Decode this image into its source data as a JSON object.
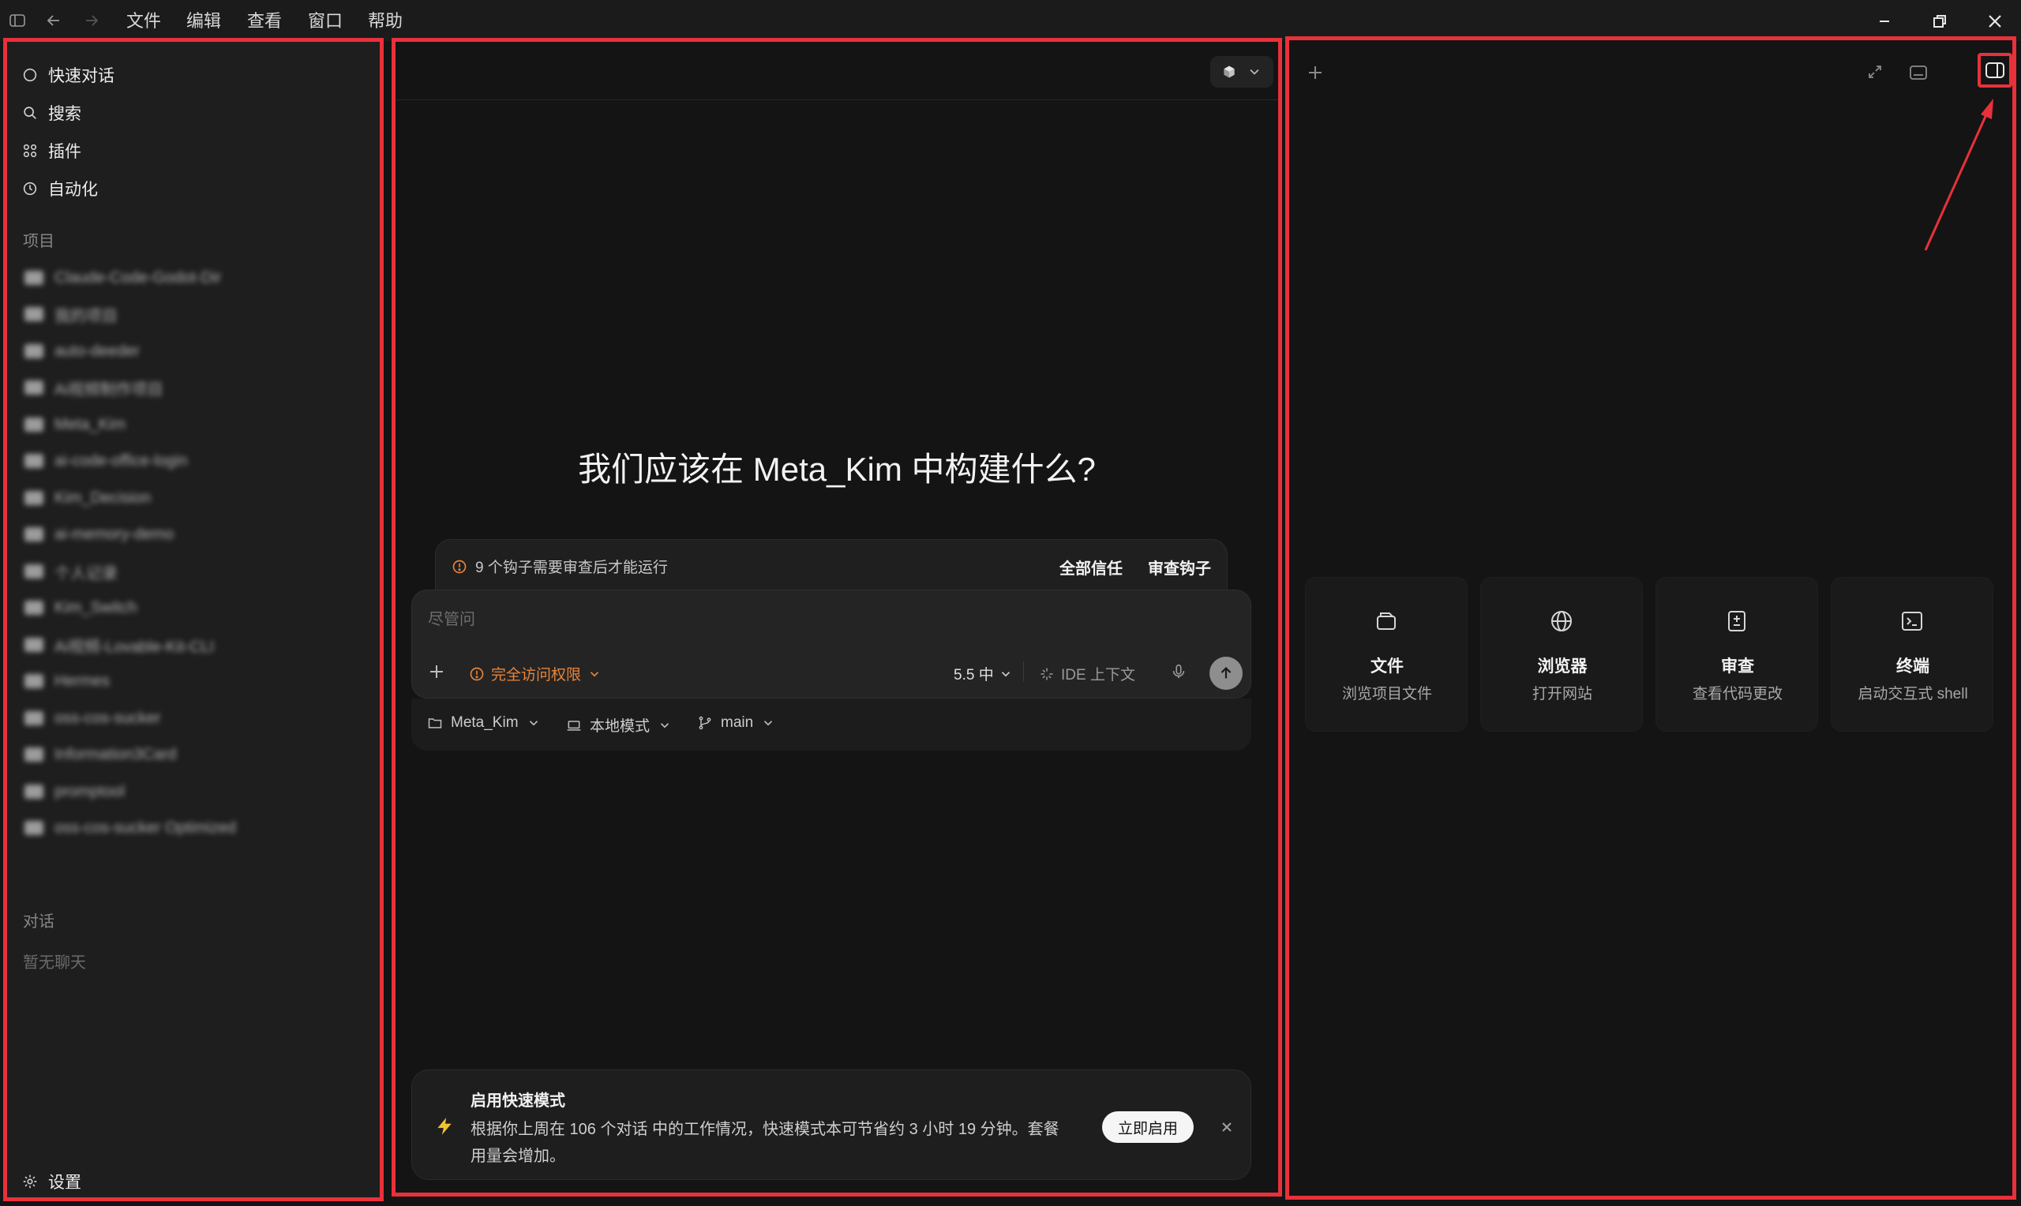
{
  "menu": [
    "文件",
    "编辑",
    "查看",
    "窗口",
    "帮助"
  ],
  "sidebar": {
    "nav": [
      "快速对话",
      "搜索",
      "插件",
      "自动化"
    ],
    "projects_label": "项目",
    "projects": [
      "Claude-Code-Godot-Dir",
      "我的项目",
      "auto-deeder",
      "Ai视频制作项目",
      "Meta_Kim",
      "ai-code-office-login",
      "Kim_Decision",
      "ai-memory-demo",
      "个人记录",
      "Kim_Switch",
      "Ai视频-Lovable-Kit-CLI",
      "Hermes",
      "oss-cos-sucker",
      "Information3Card",
      "promptool",
      "oss-cos-sucker Optimized"
    ],
    "chats_label": "对话",
    "chats_empty": "暂无聊天",
    "settings": "设置"
  },
  "center": {
    "headline": "我们应该在 Meta_Kim 中构建什么?",
    "hooks_warning": "9 个钩子需要审查后才能运行",
    "trust_all": "全部信任",
    "review_hooks": "审查钩子",
    "composer_placeholder": "尽管问",
    "permission": "完全访问权限",
    "model": "5.5 中",
    "ide_context": "IDE 上下文",
    "project": "Meta_Kim",
    "mode": "本地模式",
    "branch": "main",
    "banner": {
      "title": "启用快速模式",
      "body_line1": "根据你上周在 106 个对话 中的工作情况，快速模式本可节省约 3 小时 19 分钟。套餐",
      "body_line2": "用量会增加。",
      "enable": "立即启用"
    }
  },
  "right": {
    "cards": [
      {
        "title": "文件",
        "sub": "浏览项目文件",
        "icon": "files-icon"
      },
      {
        "title": "浏览器",
        "sub": "打开网站",
        "icon": "globe-icon"
      },
      {
        "title": "审查",
        "sub": "查看代码更改",
        "icon": "diff-icon"
      },
      {
        "title": "终端",
        "sub": "启动交互式 shell",
        "icon": "terminal-icon"
      }
    ]
  },
  "colors": {
    "highlight": "#e8313a",
    "warning": "#e8843a",
    "bolt": "#f2c230",
    "background": "#141414",
    "sidebar": "#1e1e1e"
  }
}
